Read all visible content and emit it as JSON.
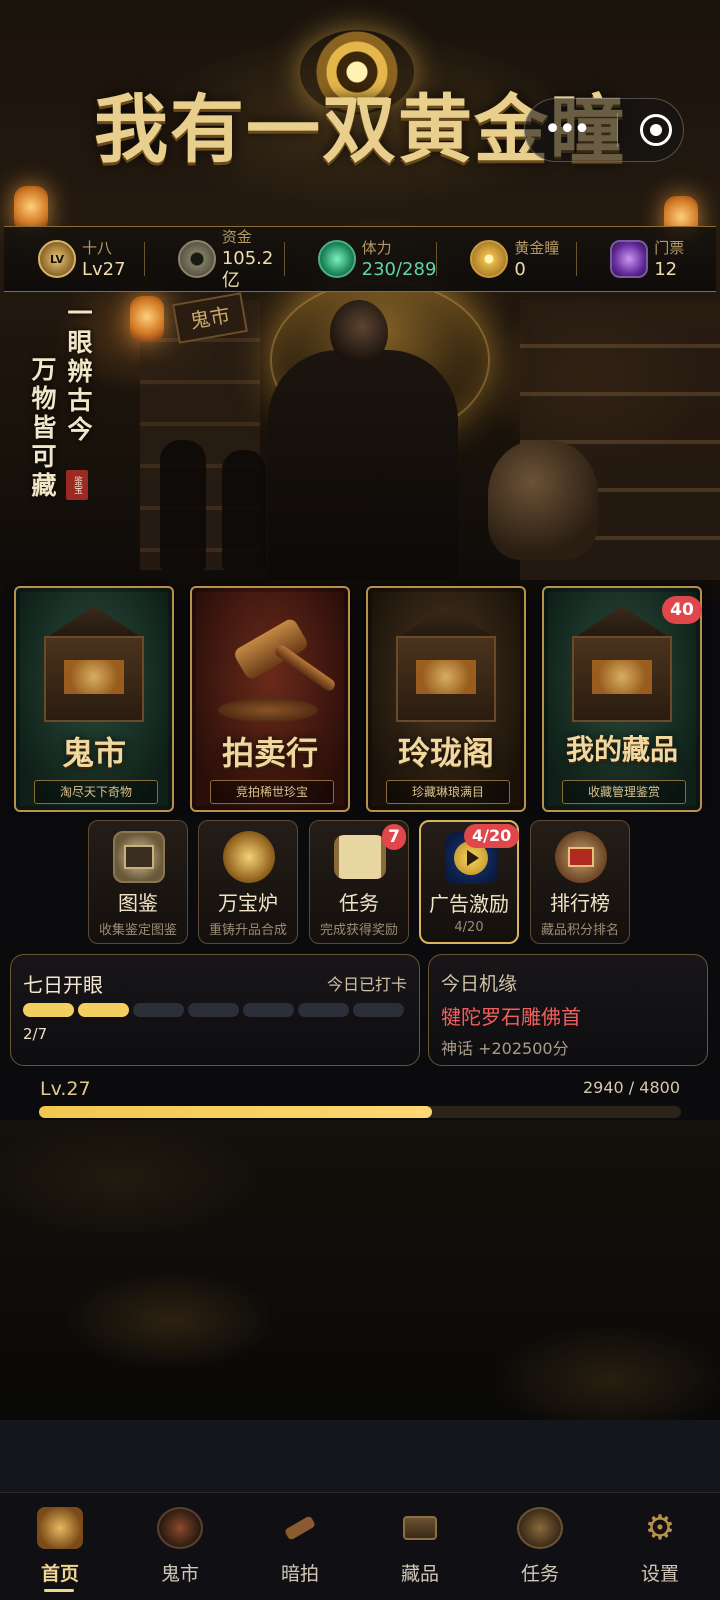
{
  "app": {
    "title": "我有一双黄金瞳"
  },
  "capsule": {
    "more_icon": "more-dots-icon",
    "close_icon": "target-circle-icon"
  },
  "stats": {
    "player": {
      "name": "十八",
      "level": "Lv27",
      "icon": "level-badge-icon"
    },
    "funds": {
      "label": "资金",
      "value": "105.2亿",
      "icon": "coin-icon"
    },
    "stamina": {
      "label": "体力",
      "value": "230/289",
      "icon": "jade-orb-icon"
    },
    "golden_pupil": {
      "label": "黄金瞳",
      "value": "0",
      "icon": "golden-eye-icon"
    },
    "tickets": {
      "label": "门票",
      "value": "12",
      "icon": "ticket-gem-icon"
    }
  },
  "hero": {
    "slogan_right": "一眼辨古今",
    "slogan_left": "万物皆可藏",
    "seal": "鉴宝",
    "shop_sign": "鬼市"
  },
  "feature_cards": {
    "ghost_market": {
      "title": "鬼市",
      "subtitle": "淘尽天下奇物"
    },
    "auction": {
      "title": "拍卖行",
      "subtitle": "竞拍稀世珍宝"
    },
    "pavilion": {
      "title": "玲珑阁",
      "subtitle": "珍藏琳琅满目"
    },
    "collection": {
      "title": "我的藏品",
      "subtitle": "收藏管理鉴赏",
      "badge": "40"
    }
  },
  "tiles": {
    "atlas": {
      "label": "图鉴",
      "sub": "收集鉴定图鉴"
    },
    "furnace": {
      "label": "万宝炉",
      "sub": "重铸升品合成"
    },
    "tasks": {
      "label": "任务",
      "sub": "完成获得奖励",
      "badge": "7"
    },
    "ads": {
      "label": "广告激励",
      "sub": "4/20",
      "badge": "4/20"
    },
    "ranking": {
      "label": "排行榜",
      "sub": "藏品积分排名"
    }
  },
  "checkin": {
    "title": "七日开眼",
    "status": "今日已打卡",
    "count": "2/7",
    "done_days": 2,
    "total_days": 7
  },
  "fortune": {
    "title": "今日机缘",
    "item": "犍陀罗石雕佛首",
    "detail": "神话 +202500分"
  },
  "level": {
    "label": "Lv.27",
    "xp_text": "2940 / 4800",
    "xp_current": 2940,
    "xp_max": 4800
  },
  "nav": {
    "items": [
      {
        "label": "首页",
        "icon": "home-pavilion-icon"
      },
      {
        "label": "鬼市",
        "icon": "ghost-market-icon"
      },
      {
        "label": "暗拍",
        "icon": "gavel-icon"
      },
      {
        "label": "藏品",
        "icon": "treasure-chest-icon"
      },
      {
        "label": "任务",
        "icon": "scroll-icon"
      },
      {
        "label": "设置",
        "icon": "gear-icon"
      }
    ],
    "active": 0
  },
  "colors": {
    "gold": "#f3cf62",
    "badge_red": "#e0474a",
    "stamina_green": "#5fd6a4",
    "fortune_red": "#f15f5f"
  }
}
